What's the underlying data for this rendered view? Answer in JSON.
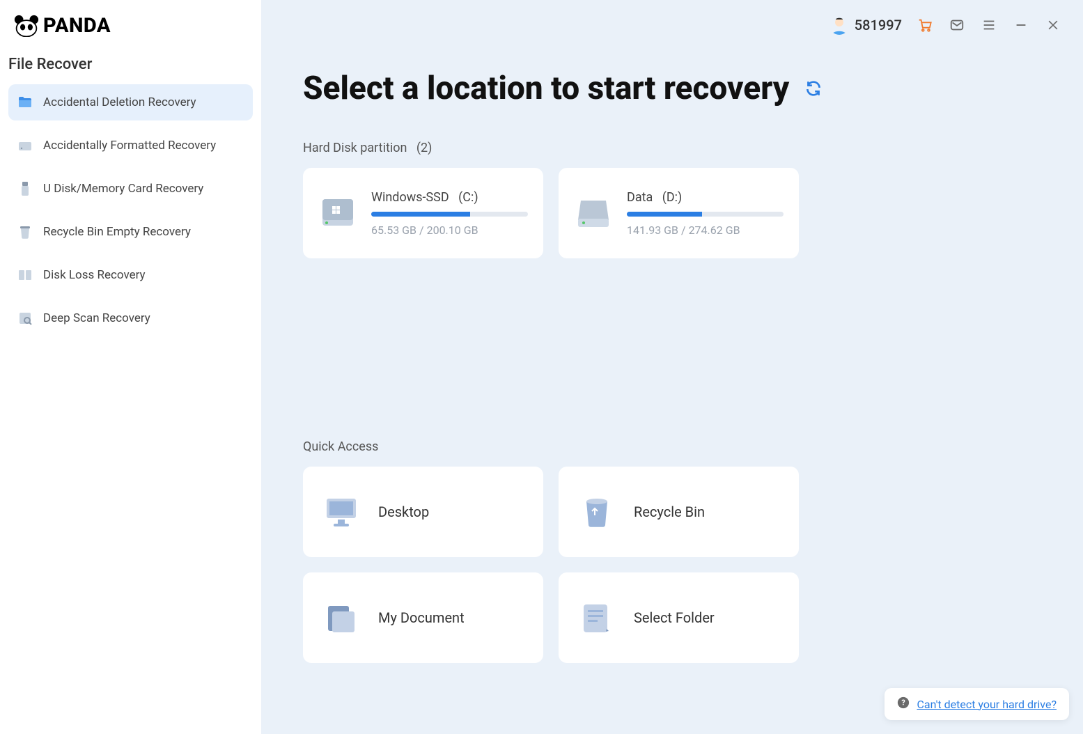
{
  "brand": {
    "name": "PANDA"
  },
  "sidebar": {
    "title": "File Recover",
    "items": [
      {
        "label": "Accidental Deletion Recovery"
      },
      {
        "label": "Accidentally Formatted Recovery"
      },
      {
        "label": "U Disk/Memory Card Recovery"
      },
      {
        "label": "Recycle Bin Empty Recovery"
      },
      {
        "label": "Disk Loss Recovery"
      },
      {
        "label": "Deep Scan Recovery"
      }
    ]
  },
  "header": {
    "user_id": "581997"
  },
  "main": {
    "title": "Select a location to start recovery",
    "partitions_label": "Hard Disk partition",
    "partitions_count": "(2)",
    "drives": [
      {
        "name": "Windows-SSD",
        "letter": "(C:)",
        "used": "65.53 GB",
        "total": "200.10 GB",
        "percent": 63
      },
      {
        "name": "Data",
        "letter": "(D:)",
        "used": "141.93 GB",
        "total": "274.62 GB",
        "percent": 48
      }
    ],
    "quick_label": "Quick Access",
    "quick": [
      {
        "label": "Desktop"
      },
      {
        "label": "Recycle Bin"
      },
      {
        "label": "My Document"
      },
      {
        "label": "Select Folder"
      }
    ]
  },
  "help": {
    "text": "Can't detect your hard drive?"
  }
}
